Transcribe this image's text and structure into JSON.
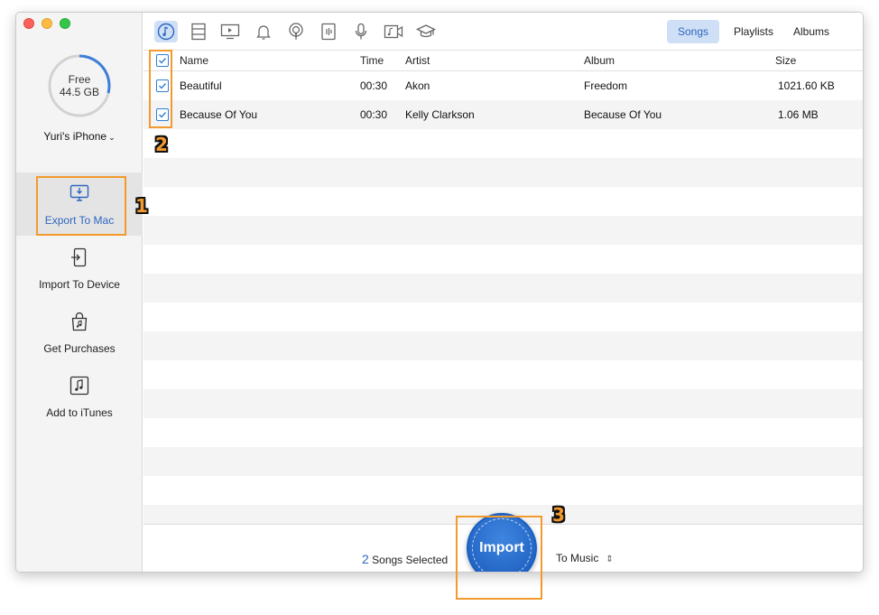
{
  "sidebar": {
    "storage": {
      "free_label": "Free",
      "free_value": "44.5 GB"
    },
    "device_name": "Yuri's iPhone",
    "items": [
      {
        "label": "Export To Mac",
        "icon": "monitor-download-icon",
        "active": true
      },
      {
        "label": "Import To Device",
        "icon": "import-device-icon",
        "active": false
      },
      {
        "label": "Get Purchases",
        "icon": "shopping-bag-icon",
        "active": false
      },
      {
        "label": "Add to iTunes",
        "icon": "music-note-icon",
        "active": false
      }
    ]
  },
  "toolbar": {
    "categories": [
      {
        "icon": "music-icon",
        "active": true
      },
      {
        "icon": "film-icon",
        "active": false
      },
      {
        "icon": "tv-icon",
        "active": false
      },
      {
        "icon": "bell-icon",
        "active": false
      },
      {
        "icon": "podcast-icon",
        "active": false
      },
      {
        "icon": "audiobook-icon",
        "active": false
      },
      {
        "icon": "microphone-icon",
        "active": false
      },
      {
        "icon": "music-video-icon",
        "active": false
      },
      {
        "icon": "graduation-cap-icon",
        "active": false
      }
    ],
    "segments": [
      {
        "label": "Songs",
        "active": true
      },
      {
        "label": "Playlists",
        "active": false
      },
      {
        "label": "Albums",
        "active": false
      }
    ]
  },
  "table": {
    "headers": {
      "name": "Name",
      "time": "Time",
      "artist": "Artist",
      "album": "Album",
      "size": "Size"
    },
    "rows": [
      {
        "name": "Beautiful",
        "time": "00:30",
        "artist": "Akon",
        "album": "Freedom",
        "size": "1021.60 KB",
        "checked": true
      },
      {
        "name": "Because Of You",
        "time": "00:30",
        "artist": "Kelly Clarkson",
        "album": "Because Of You",
        "size": "1.06 MB",
        "checked": true
      }
    ]
  },
  "bottom": {
    "selected_count": "2",
    "selected_label": "Songs Selected",
    "import_label": "Import",
    "destination": "To Music"
  },
  "annotations": {
    "step1": "1",
    "step2": "2",
    "step3": "3"
  },
  "colors": {
    "accent": "#2e66c0",
    "highlight": "#f39a2e",
    "selected_tab_bg": "#cfe0f6"
  }
}
